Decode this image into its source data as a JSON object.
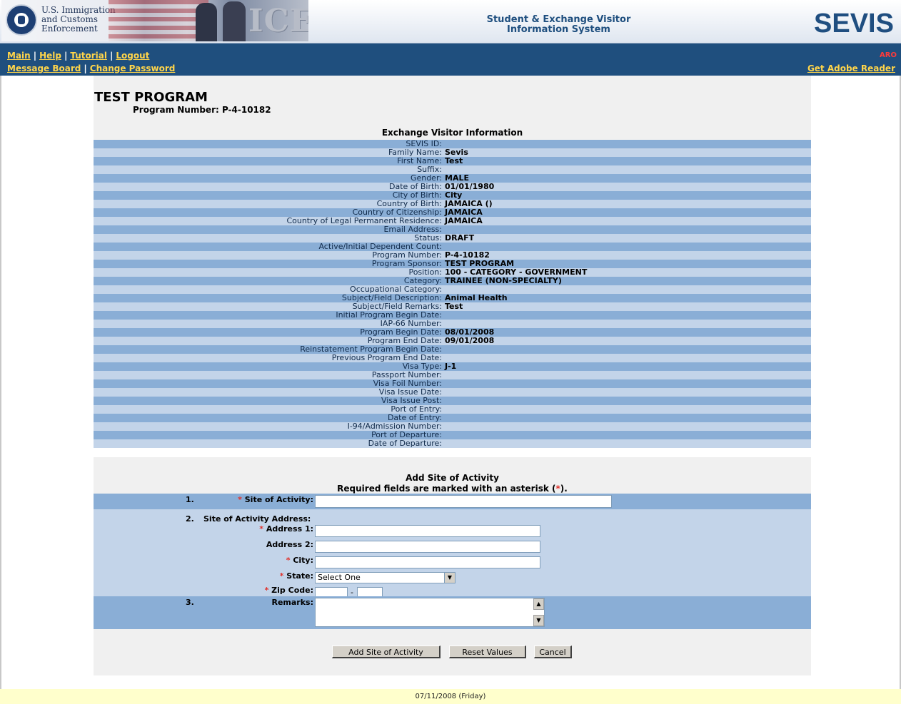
{
  "header": {
    "agency_line1": "U.S. Immigration",
    "agency_line2": "and Customs",
    "agency_line3": "Enforcement",
    "ice": "ICE",
    "app_title_line1": "Student & Exchange Visitor",
    "app_title_line2": "Information System",
    "logo": "SEVIS"
  },
  "nav": {
    "main": "Main",
    "help": "Help",
    "tutorial": "Tutorial",
    "logout": "Logout",
    "message_board": "Message Board",
    "change_password": "Change Password",
    "aro": "ARO",
    "adobe": "Get Adobe Reader",
    "separator": "|"
  },
  "program": {
    "title": "TEST PROGRAM",
    "number": "Program Number: P-4-10182"
  },
  "visitor_info": {
    "title": "Exchange Visitor Information",
    "rows": [
      {
        "label": "SEVIS ID:",
        "value": ""
      },
      {
        "label": "Family Name:",
        "value": "Sevis"
      },
      {
        "label": "First Name:",
        "value": "Test"
      },
      {
        "label": "Suffix:",
        "value": ""
      },
      {
        "label": "Gender:",
        "value": "MALE"
      },
      {
        "label": "Date of Birth:",
        "value": "01/01/1980"
      },
      {
        "label": "City of Birth:",
        "value": "City"
      },
      {
        "label": "Country of Birth:",
        "value": "JAMAICA ()"
      },
      {
        "label": "Country of Citizenship:",
        "value": "JAMAICA"
      },
      {
        "label": "Country of Legal Permanent Residence:",
        "value": "JAMAICA"
      },
      {
        "label": "Email Address:",
        "value": ""
      },
      {
        "label": "Status:",
        "value": "DRAFT"
      },
      {
        "label": "Active/Initial Dependent Count:",
        "value": ""
      },
      {
        "label": "Program Number:",
        "value": "P-4-10182"
      },
      {
        "label": "Program Sponsor:",
        "value": "TEST PROGRAM"
      },
      {
        "label": "Position:",
        "value": "100 - CATEGORY - GOVERNMENT"
      },
      {
        "label": "Category:",
        "value": "TRAINEE (NON-SPECIALTY)"
      },
      {
        "label": "Occupational Category:",
        "value": ""
      },
      {
        "label": "Subject/Field Description:",
        "value": "Animal Health"
      },
      {
        "label": "Subject/Field Remarks:",
        "value": "Test"
      },
      {
        "label": "Initial Program Begin Date:",
        "value": ""
      },
      {
        "label": "IAP-66 Number:",
        "value": ""
      },
      {
        "label": "Program Begin Date:",
        "value": "08/01/2008"
      },
      {
        "label": "Program End Date:",
        "value": "09/01/2008"
      },
      {
        "label": "Reinstatement Program Begin Date:",
        "value": ""
      },
      {
        "label": "Previous Program End Date:",
        "value": ""
      },
      {
        "label": "Visa Type:",
        "value": "J-1"
      },
      {
        "label": "Passport Number:",
        "value": ""
      },
      {
        "label": "Visa Foil Number:",
        "value": ""
      },
      {
        "label": "Visa Issue Date:",
        "value": ""
      },
      {
        "label": "Visa Issue Post:",
        "value": ""
      },
      {
        "label": "Port of Entry:",
        "value": ""
      },
      {
        "label": "Date of Entry:",
        "value": ""
      },
      {
        "label": "I-94/Admission Number:",
        "value": ""
      },
      {
        "label": "Port of Departure:",
        "value": ""
      },
      {
        "label": "Date of Departure:",
        "value": ""
      }
    ]
  },
  "form": {
    "title": "Add Site of Activity",
    "required_prefix": "Required fields are marked with an asterisk (",
    "required_star": "*",
    "required_suffix": ").",
    "star": "*",
    "num1": "1.",
    "num2": "2.",
    "num3": "3.",
    "site_label": "Site of Activity:",
    "site_value": "",
    "address_heading": "Site of Activity Address:",
    "address1_label": "Address 1:",
    "address1_value": "",
    "address2_label": "Address 2:",
    "address2_value": "",
    "city_label": "City:",
    "city_value": "",
    "state_label": "State:",
    "state_selected": "Select One",
    "zip_label": "Zip Code:",
    "zip_value": "",
    "zip4_value": "",
    "zip_dash": "-",
    "remarks_label": "Remarks:",
    "remarks_value": ""
  },
  "buttons": {
    "add": "Add Site of Activity",
    "reset": "Reset Values",
    "cancel": "Cancel"
  },
  "footer": {
    "date": "07/11/2008 (Friday)"
  },
  "colors": {
    "nav_bg": "#1f4f7e",
    "nav_link": "#ffd54a",
    "row_dark": "#8aaed6",
    "row_light": "#c3d4e9",
    "footer_bg": "#ffffcc"
  }
}
